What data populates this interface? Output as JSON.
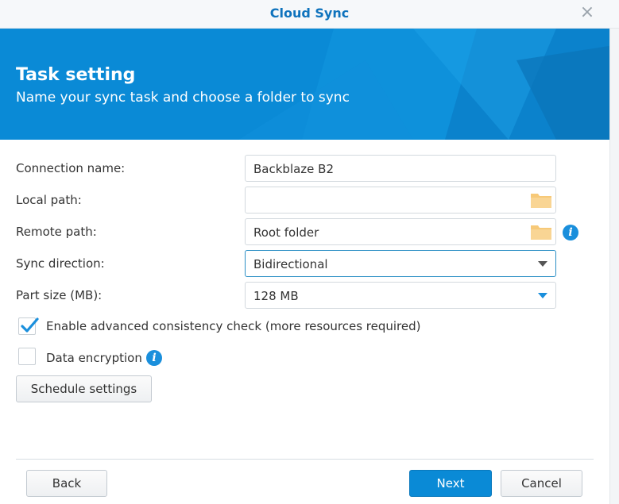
{
  "window": {
    "title": "Cloud Sync",
    "close_glyph": "×"
  },
  "header": {
    "title": "Task setting",
    "subtitle": "Name your sync task and choose a folder to sync"
  },
  "form": {
    "connection_name": {
      "label": "Connection name:",
      "value": "Backblaze B2"
    },
    "local_path": {
      "label": "Local path:",
      "value": ""
    },
    "remote_path": {
      "label": "Remote path:",
      "value": "Root folder"
    },
    "sync_direction": {
      "label": "Sync direction:",
      "value": "Bidirectional"
    },
    "part_size": {
      "label": "Part size (MB):",
      "value": "128 MB"
    },
    "advanced_check": {
      "label": "Enable advanced consistency check (more resources required)",
      "checked": true
    },
    "data_encryption": {
      "label": "Data encryption",
      "checked": false
    },
    "schedule_label": "Schedule settings"
  },
  "footer": {
    "back_label": "Back",
    "next_label": "Next",
    "cancel_label": "Cancel"
  },
  "colors": {
    "accent": "#0a8ad6",
    "title": "#0f73bd",
    "folder": "#f7c978"
  }
}
